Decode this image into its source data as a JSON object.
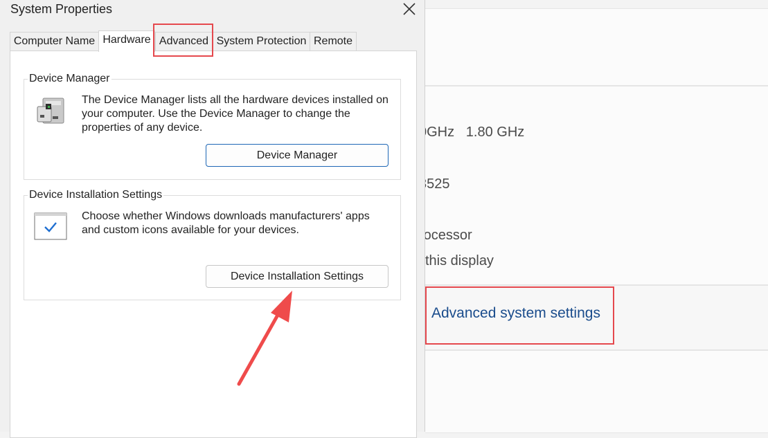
{
  "dialog": {
    "title": "System Properties",
    "tabs": [
      {
        "label": "Computer Name"
      },
      {
        "label": "Hardware"
      },
      {
        "label": "Advanced"
      },
      {
        "label": "System Protection"
      },
      {
        "label": "Remote"
      }
    ],
    "active_tab": "Hardware",
    "device_manager": {
      "group_label": "Device Manager",
      "description": "The Device Manager lists all the hardware devices installed on your computer. Use the Device Manager to change the properties of any device.",
      "button_label": "Device Manager"
    },
    "device_installation": {
      "group_label": "Device Installation Settings",
      "description": "Choose whether Windows downloads manufacturers' apps and custom icons available for your devices.",
      "button_label": "Device Installation Settings"
    }
  },
  "background": {
    "processor_speed": "0GHz   1.80 GHz",
    "build_fragment": "3525",
    "processor_fragment": "rocessor",
    "display_fragment": "this display",
    "advanced_link": "Advanced system settings"
  },
  "colors": {
    "annotation": "#e5484d",
    "link": "#1a4c8c",
    "primary_button_border": "#1d66b5"
  },
  "icons": [
    "close-icon",
    "hardware-device-icon",
    "checkbox-settings-icon"
  ]
}
